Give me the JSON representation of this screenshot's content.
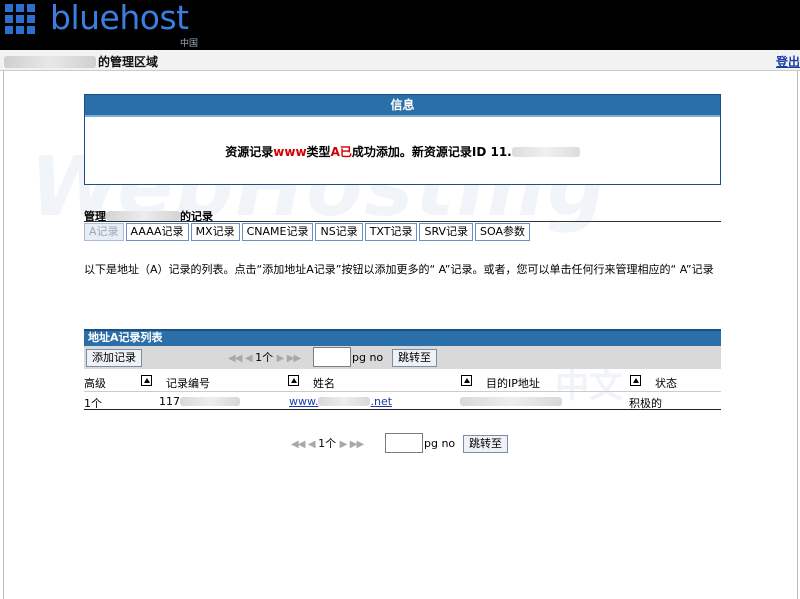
{
  "header": {
    "logo_text": "bluehost",
    "logo_sub": "中国",
    "title": "的管理区域",
    "logout": "登出"
  },
  "watermark": {
    "text": "WebHosting",
    "text2": "中文"
  },
  "info": {
    "title": "信息",
    "msg_part1": "资源记录",
    "msg_red1": "www",
    "msg_part2": "类型",
    "msg_red2": "A已",
    "msg_part3": "成功添加。新资源记录ID 11."
  },
  "manage": {
    "prefix": "管理",
    "suffix": "的记录"
  },
  "tabs": [
    {
      "label": "A记录",
      "active": true
    },
    {
      "label": "AAAA记录"
    },
    {
      "label": "MX记录"
    },
    {
      "label": "CNAME记录"
    },
    {
      "label": "NS记录"
    },
    {
      "label": "TXT记录"
    },
    {
      "label": "SRV记录"
    },
    {
      "label": "SOA参数"
    }
  ],
  "description": "以下是地址（A）记录的列表。点击“添加地址A记录”按钮以添加更多的“ A”记录。或者，您可以单击任何行来管理相应的“ A”记录",
  "list": {
    "title": "地址A记录列表",
    "add_button": "添加记录",
    "pager_text": "1个",
    "pg_no": "pg no",
    "jump": "跳转至",
    "columns": [
      "高级",
      "记录编号",
      "姓名",
      "目的IP地址",
      "状态"
    ],
    "row": {
      "level": "1个",
      "record_id": "117",
      "name": "www.",
      "name_tail": ".net",
      "status": "积极的"
    }
  },
  "bottom_pager": {
    "text": "1个",
    "pg_no": "pg no",
    "jump": "跳转至"
  }
}
